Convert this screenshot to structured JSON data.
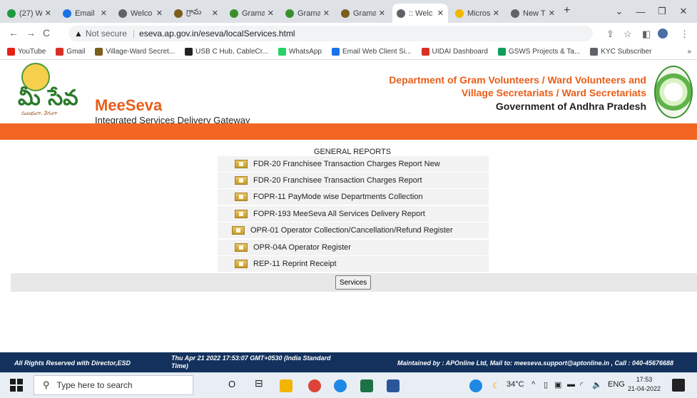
{
  "browser": {
    "tabs": [
      {
        "label": "(27) W",
        "color": "#1c9b3f"
      },
      {
        "label": "Email",
        "color": "#1a73e8"
      },
      {
        "label": "Welco",
        "color": "#5f6368"
      },
      {
        "label": "గ్రామ",
        "color": "#7a5e1a"
      },
      {
        "label": "Grama",
        "color": "#3a8f2d"
      },
      {
        "label": "Grama",
        "color": "#3a8f2d"
      },
      {
        "label": "Grama",
        "color": "#7a5e1a"
      },
      {
        "label": ":: Welc",
        "color": "#5f6368"
      },
      {
        "label": "Micros",
        "color": "#f2b600"
      },
      {
        "label": "New T",
        "color": "#5f6368"
      }
    ],
    "url_security": "Not secure",
    "url": "eseva.ap.gov.in/eseva/localServices.html"
  },
  "bookmarks": [
    {
      "label": "YouTube",
      "color": "#e62117"
    },
    {
      "label": "Gmail",
      "color": "#d93025"
    },
    {
      "label": "Village-Ward Secret...",
      "color": "#7a5e1a"
    },
    {
      "label": "USB C Hub, CableCr...",
      "color": "#222222"
    },
    {
      "label": "WhatsApp",
      "color": "#25d366"
    },
    {
      "label": "Email Web Client Si...",
      "color": "#1a73e8"
    },
    {
      "label": "UIDAI Dashboard",
      "color": "#d93025"
    },
    {
      "label": "GSWS Projects & Ta...",
      "color": "#0f9d58"
    },
    {
      "label": "KYC Subscriber",
      "color": "#5f6368"
    }
  ],
  "header": {
    "logo_text": "మీ సేవ",
    "logo_sub": "సులభంగా, వేగంగా",
    "brand": "MeeSeva",
    "tagline": "Integrated Services Delivery Gateway",
    "dept_line1": "Department of Gram Volunteers / Ward Volunteers and",
    "dept_line2": "Village Secretariats / Ward Secretariats",
    "dept_line3": "Government of Andhra Pradesh"
  },
  "reports": {
    "title": "GENERAL REPORTS",
    "items": [
      "FDR-20 Franchisee Transaction Charges Report New",
      "FDR-20 Franchisee Transaction Charges Report",
      "FOPR-11 PayMode wise Departments Collection",
      "FOPR-193 MeeSeva All Services Delivery Report",
      "OPR-01 Operator Collection/Cancellation/Refund Register",
      "OPR-04A Operator Register",
      "REP-11 Reprint Receipt"
    ],
    "button_label": "Services"
  },
  "footer": {
    "rights": "All Rights Reserved with Director,ESD",
    "datetime": "Thu Apr 21 2022 17:53:07 GMT+0530 (India Standard Time)",
    "maintained": "Maintained by : APOnline Ltd, Mail to: meeseva.support@aptonline.in , Call : 040-45676688"
  },
  "taskbar": {
    "search_placeholder": "Type here to search",
    "weather": "34°C",
    "lang": "ENG",
    "time": "17:53",
    "date": "21-04-2022"
  }
}
